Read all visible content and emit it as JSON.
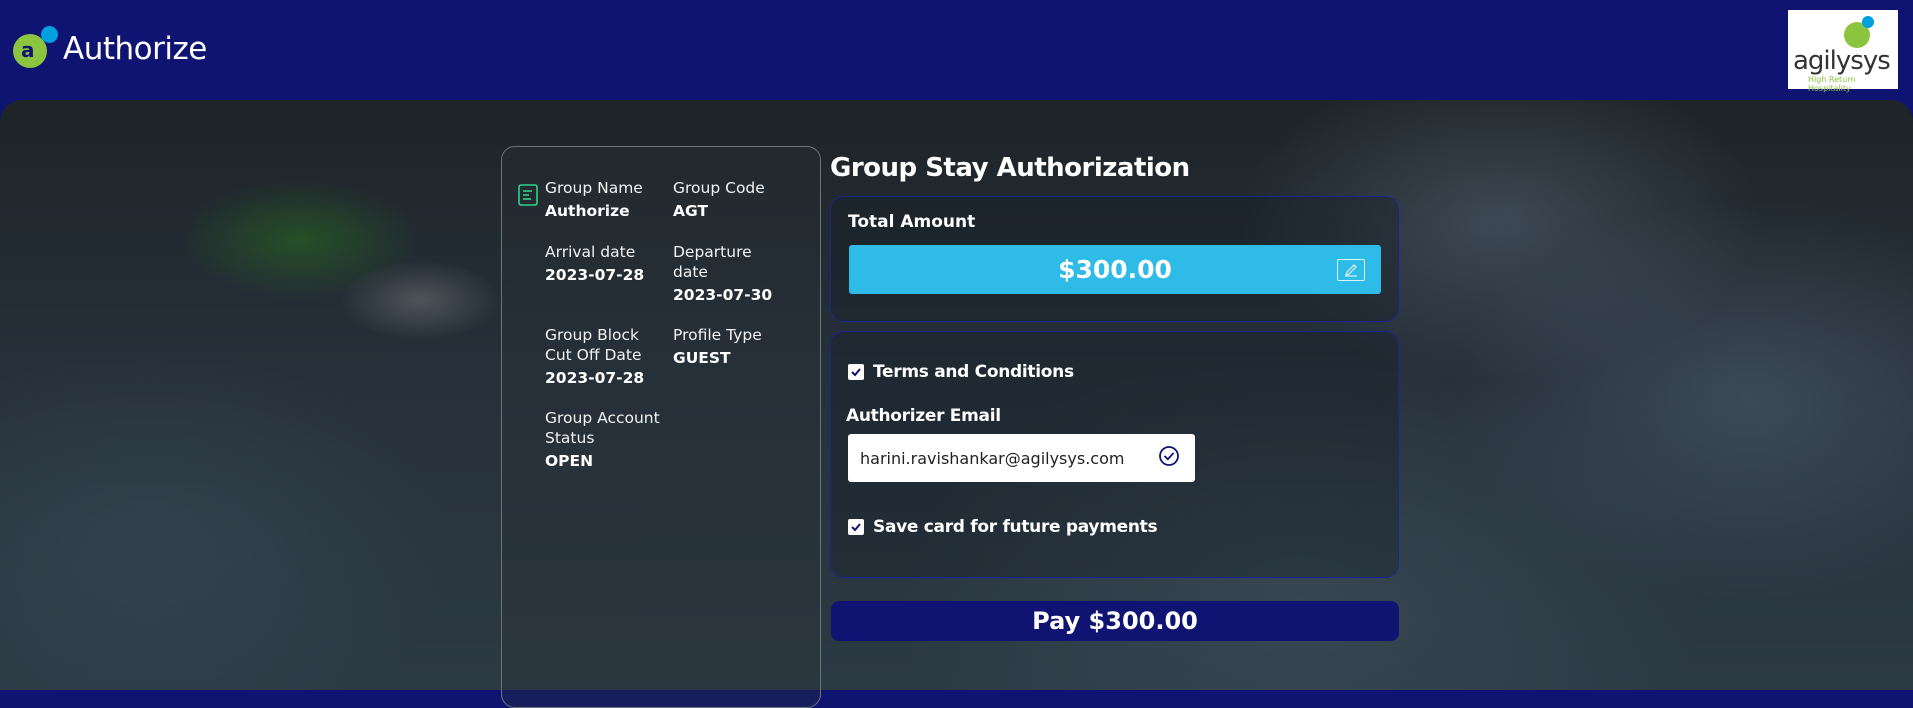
{
  "app": {
    "title": "Authorize"
  },
  "partner": {
    "brand": "agilysys",
    "tagline": "High Return Hospitality"
  },
  "group_details": {
    "group_name_label": "Group Name",
    "group_name": "Authorize",
    "group_code_label": "Group Code",
    "group_code": "AGT",
    "arrival_label": "Arrival date",
    "arrival": "2023-07-28",
    "departure_label_1": "Departure",
    "departure_label_2": "date",
    "departure": "2023-07-30",
    "cutoff_label_1": "Group Block",
    "cutoff_label_2": "Cut Off Date",
    "cutoff": "2023-07-28",
    "profile_type_label": "Profile Type",
    "profile_type": "GUEST",
    "account_status_label_1": "Group Account",
    "account_status_label_2": "Status",
    "account_status": "OPEN"
  },
  "authorization": {
    "title": "Group Stay Authorization",
    "total_amount_label": "Total Amount",
    "total_amount": "$300.00",
    "terms_label": "Terms and Conditions",
    "terms_checked": true,
    "email_label": "Authorizer Email",
    "email_value": "harini.ravishankar@agilysys.com",
    "save_card_label": "Save card for future payments",
    "save_card_checked": true,
    "pay_button_label": "Pay $300.00"
  },
  "colors": {
    "header_bg": "#0f1473",
    "amount_bg": "#2fbbe8",
    "brand_green": "#8bc53f",
    "brand_blue": "#00a0e0"
  },
  "icons": {
    "brand": "agilysys-a-logo-icon",
    "details": "document-icon",
    "edit": "edit-pencil-icon",
    "verified": "check-circle-icon",
    "checkbox": "checkmark-icon"
  }
}
